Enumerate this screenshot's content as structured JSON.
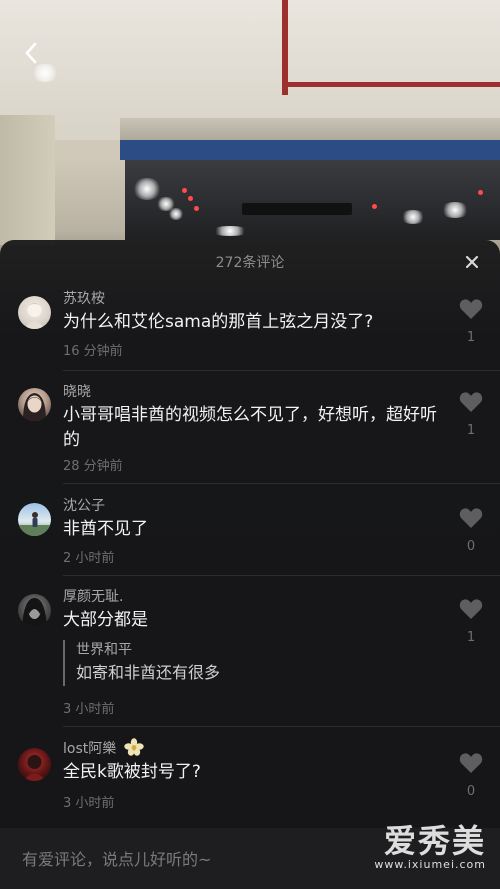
{
  "panel": {
    "title": "272条评论"
  },
  "comments": [
    {
      "user": "苏玖桉",
      "text": "为什么和艾伦sama的那首上弦之月没了?",
      "time": "16 分钟前",
      "likes": "1"
    },
    {
      "user": "晓晓",
      "text": "小哥哥唱非酋的视频怎么不见了，好想听，超好听的",
      "time": "28 分钟前",
      "likes": "1"
    },
    {
      "user": "沈公子",
      "text": "非酋不见了",
      "time": "2 小时前",
      "likes": "0"
    },
    {
      "user": "厚颜无耻.",
      "text": "大部分都是",
      "reply": {
        "user": "世界和平",
        "text": "如寄和非酋还有很多"
      },
      "time": "3 小时前",
      "likes": "1"
    },
    {
      "user": "lost阿樂",
      "text": "全民k歌被封号了?",
      "time": "3 小时前",
      "likes": "0"
    }
  ],
  "input": {
    "placeholder": "有爱评论，说点儿好听的~"
  },
  "watermark": {
    "main": "爱秀美",
    "sub": "www.ixiumei.com"
  },
  "colors": {
    "panel_bg": "#161618",
    "text_primary": "#f2f2f2",
    "text_secondary": "#a8a8a8",
    "text_muted": "#6e6e6e"
  },
  "icons": {
    "back": "chevron-left-icon",
    "close": "close-icon",
    "like": "heart-icon",
    "user_badge": "flower-icon"
  }
}
